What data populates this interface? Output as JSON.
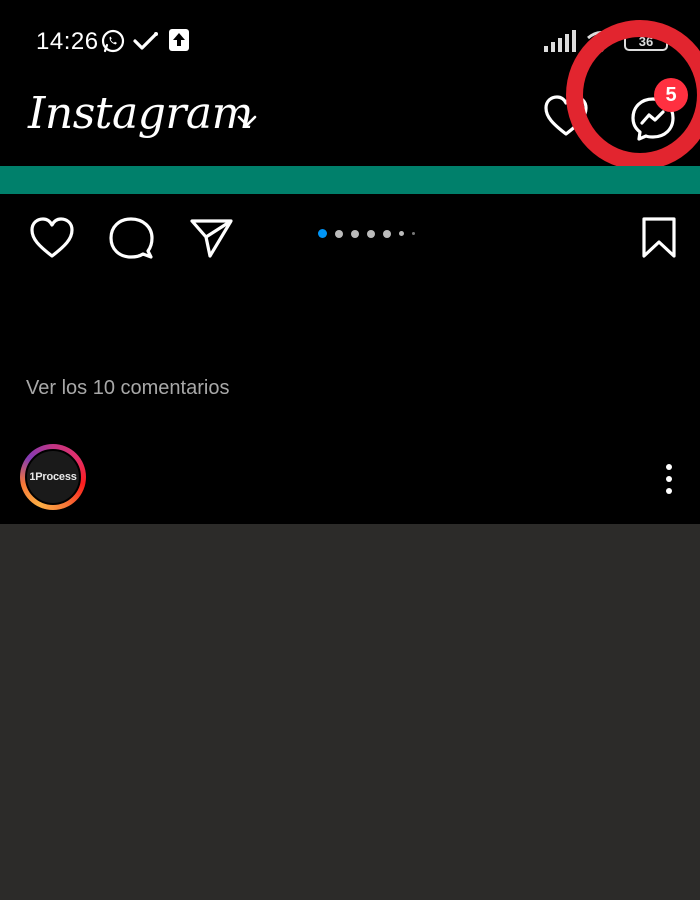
{
  "status_bar": {
    "time": "14:26",
    "battery": "36",
    "icons": [
      "whatsapp-icon",
      "check-icon",
      "upload-icon",
      "signal-icon",
      "wifi-icon",
      "battery-icon"
    ]
  },
  "header": {
    "logo_text": "Instagram",
    "messenger_badge": "5",
    "icons": [
      "chevron-down-icon",
      "heart-icon",
      "messenger-icon"
    ]
  },
  "post": {
    "carousel_dots": 6,
    "carousel_active": 1,
    "comments_link": "Ver los 10 comentarios"
  },
  "next_post": {
    "avatar_text": "1Process"
  },
  "colors": {
    "background": "#000000",
    "teal_bar": "#00806b",
    "badge": "#ff3040",
    "highlight_ring": "#e2252f",
    "dot_active": "#0095f6",
    "media_placeholder": "#2c2b29"
  }
}
